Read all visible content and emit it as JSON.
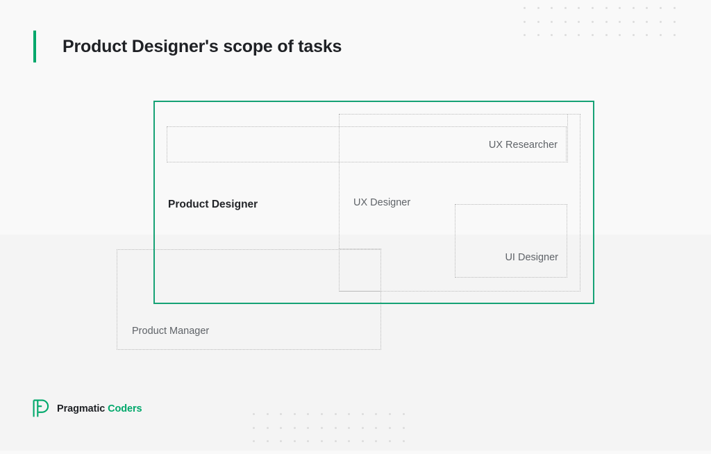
{
  "page": {
    "title": "Product Designer's scope of tasks",
    "background_top": "#f9f9f9",
    "background_bottom": "#f4f4f4",
    "accent_color": "#00a86b"
  },
  "diagram": {
    "scope_border_color": "#16a275",
    "dashed_border_color": "#b9b9b9",
    "boxes": [
      {
        "name": "product-designer-scope",
        "label": "Product Designer",
        "style": "solid-green",
        "emphasis": "strong"
      },
      {
        "name": "empty-top-left",
        "label": "",
        "style": "dashed"
      },
      {
        "name": "ux-researcher",
        "label": "UX Researcher",
        "style": "dashed"
      },
      {
        "name": "ux-designer",
        "label": "UX Designer",
        "style": "dashed"
      },
      {
        "name": "ui-designer",
        "label": "UI Designer",
        "style": "dashed"
      },
      {
        "name": "empty-small",
        "label": "",
        "style": "dashed"
      },
      {
        "name": "product-manager",
        "label": "Product Manager",
        "style": "dashed"
      }
    ],
    "labels": {
      "product_designer": "Product Designer",
      "ux_researcher": "UX Researcher",
      "ux_designer": "UX Designer",
      "ui_designer": "UI Designer",
      "product_manager": "Product Manager"
    }
  },
  "decoration": {
    "dot_color": "#dcdcdc",
    "dot_grid_columns": 12,
    "dot_grid_rows": 3
  },
  "footer": {
    "logo_icon": "pragmatic-coders-p-mark",
    "brand_word_1": "Pragmatic",
    "brand_word_2": "Coders"
  }
}
